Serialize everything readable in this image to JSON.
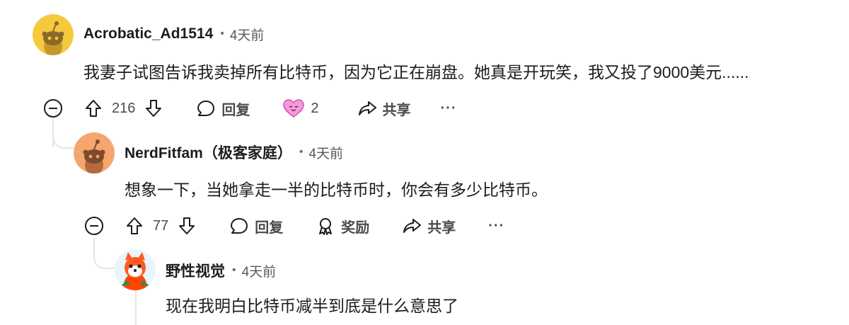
{
  "comments": [
    {
      "author": "Acrobatic_Ad1514",
      "time": "4天前",
      "body": "我妻子试图告诉我卖掉所有比特币，因为它正在崩盘。她真是开玩笑，我又投了9000美元......",
      "upvotes": "216",
      "reply_label": "回复",
      "award_count": "2",
      "share_label": "共享",
      "more_label": "···",
      "avatar_color": "#f6c93c"
    },
    {
      "author": "NerdFitfam（极客家庭）",
      "time": "4天前",
      "body": "想象一下，当她拿走一半的比特币时，你会有多少比特币。",
      "upvotes": "77",
      "reply_label": "回复",
      "award_label": "奖励",
      "share_label": "共享",
      "more_label": "···",
      "avatar_color": "#f5a66e"
    },
    {
      "author": "野性视觉",
      "time": "4天前",
      "body": "现在我明白比特币减半到底是什么意思了",
      "avatar_color": "#ff4500"
    }
  ],
  "meta_separator": "•"
}
